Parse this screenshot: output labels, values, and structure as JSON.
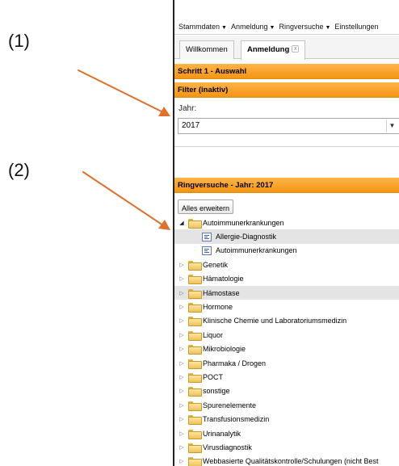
{
  "callouts": {
    "one": "(1)",
    "two": "(2)"
  },
  "menu": [
    "Stammdaten",
    "Anmeldung",
    "Ringversuche",
    "Einstellungen"
  ],
  "tabs": {
    "willkommen": "Willkommen",
    "anmeldung": "Anmeldung",
    "close": "x"
  },
  "headers": {
    "step": "Schritt 1 - Auswahl",
    "filter": "Filter (inaktiv)",
    "ring": "Ringversuche - Jahr: 2017"
  },
  "filter": {
    "label": "Jahr:",
    "selected": "2017"
  },
  "expand_button": "Alles erweitern",
  "tree": {
    "expanded": "Autoimmunerkrankungen",
    "children": [
      "Allergie-Diagnostik",
      "Autoimmunerkrankungen"
    ],
    "folders": [
      "Genetik",
      "Hämatologie",
      "Hämostase",
      "Hormone",
      "Klinische Chemie und Laboratoriumsmedizin",
      "Liquor",
      "Mikrobiologie",
      "Pharmaka / Drogen",
      "POCT",
      "sonstige",
      "Spurenelemente",
      "Transfusionsmedizin",
      "Urinanalytik",
      "Virusdiagnostik",
      "Webbasierte Qualitätskontrolle/Schulungen (nicht Best"
    ]
  },
  "colors": {
    "accent": "#f39512",
    "highlight": "#e4e4e4",
    "arrow": "#e0702a"
  }
}
